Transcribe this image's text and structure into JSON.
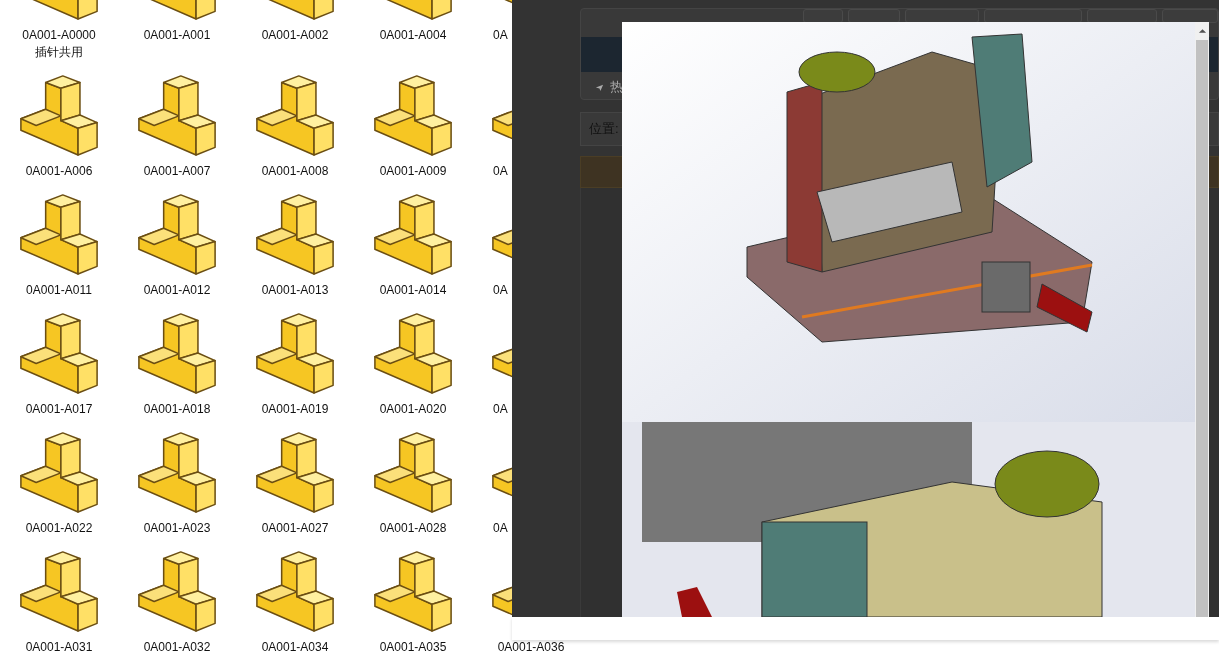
{
  "files": [
    {
      "label": "0A001-A0000",
      "label_2": "插针共用",
      "clipped": false
    },
    {
      "label": "0A001-A001",
      "clipped": false
    },
    {
      "label": "0A001-A002",
      "clipped": false
    },
    {
      "label": "0A001-A004",
      "clipped": false
    },
    {
      "label": "0A",
      "clipped": true
    },
    {
      "label": "0A001-A006",
      "clipped": false
    },
    {
      "label": "0A001-A007",
      "clipped": false
    },
    {
      "label": "0A001-A008",
      "clipped": false
    },
    {
      "label": "0A001-A009",
      "clipped": false
    },
    {
      "label": "0A",
      "clipped": true
    },
    {
      "label": "0A001-A011",
      "clipped": false
    },
    {
      "label": "0A001-A012",
      "clipped": false
    },
    {
      "label": "0A001-A013",
      "clipped": false
    },
    {
      "label": "0A001-A014",
      "clipped": false
    },
    {
      "label": "0A",
      "clipped": true
    },
    {
      "label": "0A001-A017",
      "clipped": false
    },
    {
      "label": "0A001-A018",
      "clipped": false
    },
    {
      "label": "0A001-A019",
      "clipped": false
    },
    {
      "label": "0A001-A020",
      "clipped": false
    },
    {
      "label": "0A",
      "clipped": true
    },
    {
      "label": "0A001-A022",
      "clipped": false
    },
    {
      "label": "0A001-A023",
      "clipped": false
    },
    {
      "label": "0A001-A027",
      "clipped": false
    },
    {
      "label": "0A001-A028",
      "clipped": false
    },
    {
      "label": "0A",
      "clipped": true
    },
    {
      "label": "0A001-A031",
      "clipped": false
    },
    {
      "label": "0A001-A032",
      "clipped": false
    },
    {
      "label": "0A001-A034",
      "clipped": false
    },
    {
      "label": "0A001-A035",
      "clipped": false
    },
    {
      "label": "0A001-A036",
      "clipped": false
    }
  ],
  "background_page": {
    "hot_label": "热",
    "location_label": "位置:"
  }
}
